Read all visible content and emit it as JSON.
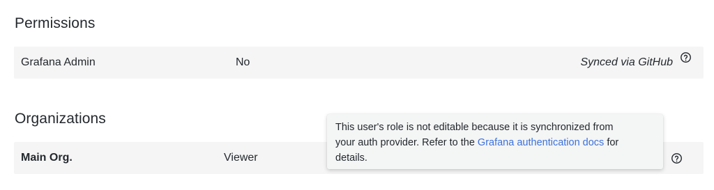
{
  "permissions": {
    "title": "Permissions",
    "row": {
      "name": "Grafana Admin",
      "value": "No",
      "sync_text": "Synced via GitHub"
    }
  },
  "organizations": {
    "title": "Organizations",
    "rows": [
      {
        "name": "Main Org.",
        "role": "Viewer"
      }
    ]
  },
  "tooltip": {
    "line1": "This user's role is not editable because it is synchronized from",
    "line2_prefix": "your auth provider. Refer to the ",
    "link_text": "Grafana authentication docs",
    "line2_suffix": " for",
    "line3": "details."
  },
  "colors": {
    "link": "#3d71d9",
    "row_background": "#f5f5f5"
  },
  "icons": {
    "help": "question-circle-icon"
  }
}
